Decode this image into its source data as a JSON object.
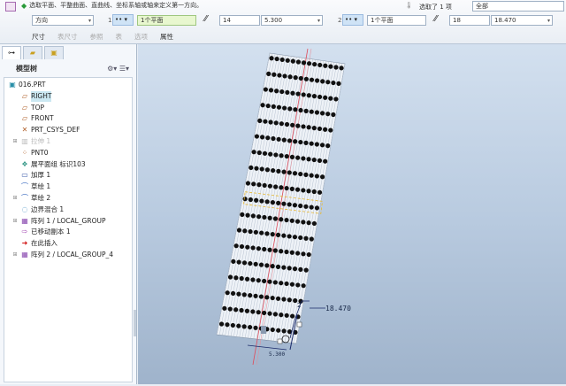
{
  "ribbon": {
    "message": "选取平面、平整曲面、直曲线、坐标系轴或轴来定义第一方向。",
    "type_select": "方向",
    "dir1": {
      "index": "1",
      "reference": "1个平面",
      "count": "14",
      "spacing": "5.300"
    },
    "dir2": {
      "index": "2",
      "reference": "1个平面",
      "count": "18",
      "spacing": "18.470"
    },
    "selection_status": "选取了 1 项",
    "filter": "全部",
    "tabs": [
      {
        "label": "尺寸",
        "enabled": true
      },
      {
        "label": "表尺寸",
        "enabled": false
      },
      {
        "label": "参照",
        "enabled": false
      },
      {
        "label": "表",
        "enabled": false
      },
      {
        "label": "选项",
        "enabled": false
      },
      {
        "label": "属性",
        "enabled": true
      }
    ]
  },
  "model_tree": {
    "title": "模型树",
    "items": [
      {
        "label": "016.PRT",
        "icon": "part-icon",
        "expand": false,
        "level": 0
      },
      {
        "label": "RIGHT",
        "icon": "datum-plane-icon",
        "selected": true,
        "level": 1
      },
      {
        "label": "TOP",
        "icon": "datum-plane-icon",
        "level": 1
      },
      {
        "label": "FRONT",
        "icon": "datum-plane-icon",
        "level": 1
      },
      {
        "label": "PRT_CSYS_DEF",
        "icon": "csys-icon",
        "level": 1
      },
      {
        "label": "拉伸 1",
        "icon": "extrude-icon",
        "dim": true,
        "expand": true,
        "level": 1
      },
      {
        "label": "PNT0",
        "icon": "datum-point-icon",
        "level": 1
      },
      {
        "label": "展平面组 标识103",
        "icon": "flatten-icon",
        "level": 1
      },
      {
        "label": "加厚 1",
        "icon": "thicken-icon",
        "level": 1
      },
      {
        "label": "草绘 1",
        "icon": "sketch-icon",
        "level": 1
      },
      {
        "label": "草绘 2",
        "icon": "sketch-icon",
        "expand": true,
        "level": 1
      },
      {
        "label": "边界混合 1",
        "icon": "boundary-blend-icon",
        "level": 1
      },
      {
        "label": "阵列 1 / LOCAL_GROUP",
        "icon": "pattern-icon",
        "expand": true,
        "level": 1
      },
      {
        "label": "已移动副本 1",
        "icon": "moved-copy-icon",
        "level": 1
      },
      {
        "label": "在此插入",
        "icon": "insert-here-icon",
        "level": 1
      },
      {
        "label": "阵列 2 / LOCAL_GROUP_4",
        "icon": "pattern-icon",
        "expand": true,
        "level": 1
      }
    ]
  },
  "viewport": {
    "dimension_label": "18.470",
    "dimension_label_2": "5.300",
    "dimension_index": "2",
    "rows": 18,
    "dots_per_row": 14
  }
}
